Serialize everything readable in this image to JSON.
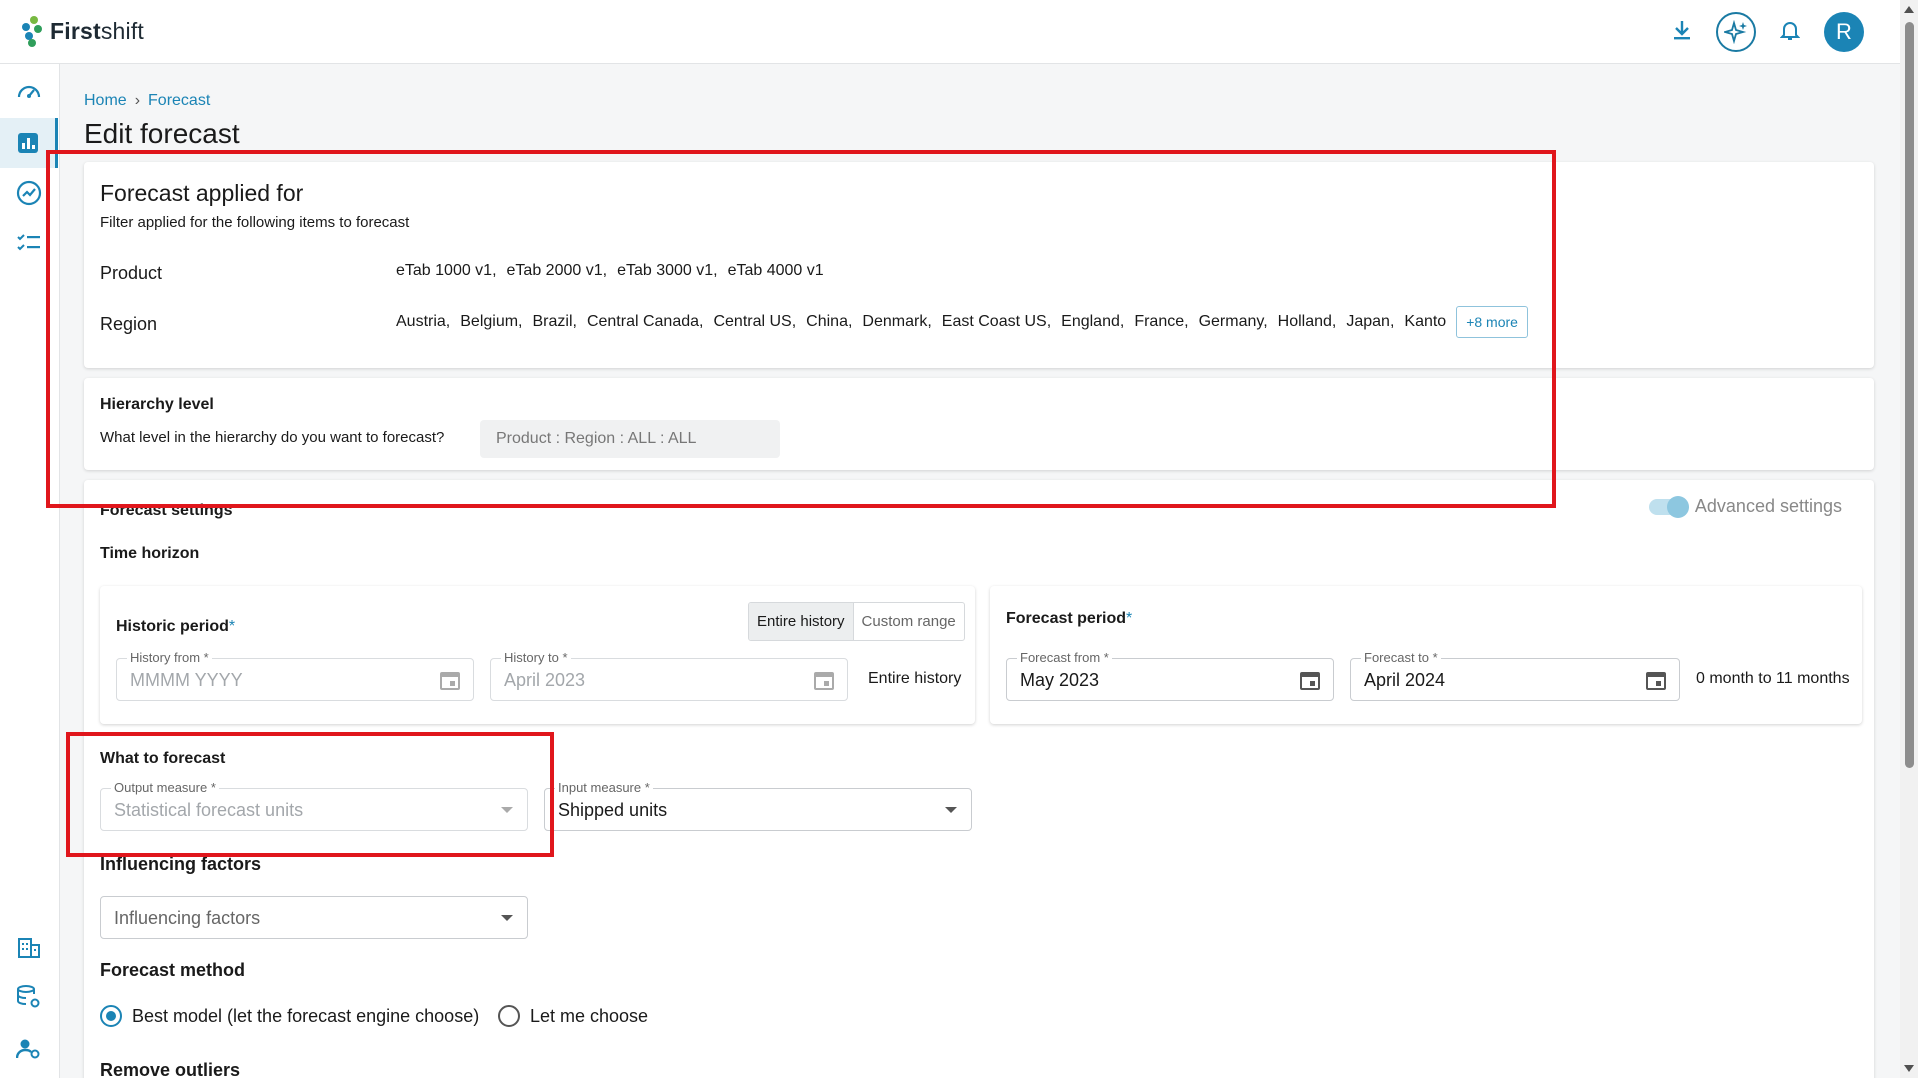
{
  "brand": {
    "name_bold": "First",
    "name_rest": "shift"
  },
  "colors": {
    "accent": "#1b84b5",
    "highlight": "#e0161c"
  },
  "topbar": {
    "avatar_initial": "R",
    "icons": [
      "download-icon",
      "ai-sparkle-icon",
      "bell-icon"
    ]
  },
  "sidenav": {
    "icons": [
      "dashboard-icon",
      "chart-icon",
      "trend-icon",
      "checklist-icon",
      "building-icon",
      "database-settings-icon",
      "user-settings-icon"
    ]
  },
  "breadcrumb": {
    "home": "Home",
    "sep": "›",
    "current": "Forecast"
  },
  "page_title": "Edit forecast",
  "applied_for": {
    "title": "Forecast applied for",
    "subtitle": "Filter applied for the following items to forecast",
    "product_label": "Product",
    "products": [
      "eTab 1000 v1,",
      "eTab 2000 v1,",
      "eTab 3000 v1,",
      "eTab 4000 v1"
    ],
    "region_label": "Region",
    "regions": [
      "Austria,",
      "Belgium,",
      "Brazil,",
      "Central Canada,",
      "Central US,",
      "China,",
      "Denmark,",
      "East Coast US,",
      "England,",
      "France,",
      "Germany,",
      "Holland,",
      "Japan,",
      "Kanto"
    ],
    "more_label": "+8 more"
  },
  "hierarchy": {
    "title": "Hierarchy level",
    "question": "What level in the hierarchy do you want to forecast?",
    "value": "Product : Region : ALL : ALL"
  },
  "settings": {
    "title": "Forecast settings",
    "advanced_label": "Advanced settings",
    "time_horizon": "Time horizon",
    "historic": {
      "title": "Historic period",
      "required": "*",
      "seg_entire": "Entire history",
      "seg_custom": "Custom range",
      "from_label": "History from *",
      "from_placeholder": "MMMM YYYY",
      "to_label": "History to *",
      "to_value": "April 2023",
      "mode_text": "Entire history"
    },
    "forecast_period": {
      "title": "Forecast period",
      "required": "*",
      "from_label": "Forecast from *",
      "from_value": "May 2023",
      "to_label": "Forecast to *",
      "to_value": "April 2024",
      "range_text": "0 month to 11 months"
    },
    "what_to_forecast": {
      "title": "What to forecast",
      "output_label": "Output measure *",
      "output_value": "Statistical forecast units",
      "input_label": "Input measure *",
      "input_value": "Shipped units"
    },
    "influencing": {
      "title": "Influencing factors",
      "placeholder": "Influencing factors"
    },
    "method": {
      "title": "Forecast method",
      "option_best": "Best model (let the forecast engine choose)",
      "option_choose": "Let me choose",
      "selected": "best"
    },
    "outliers_title": "Remove outliers"
  }
}
